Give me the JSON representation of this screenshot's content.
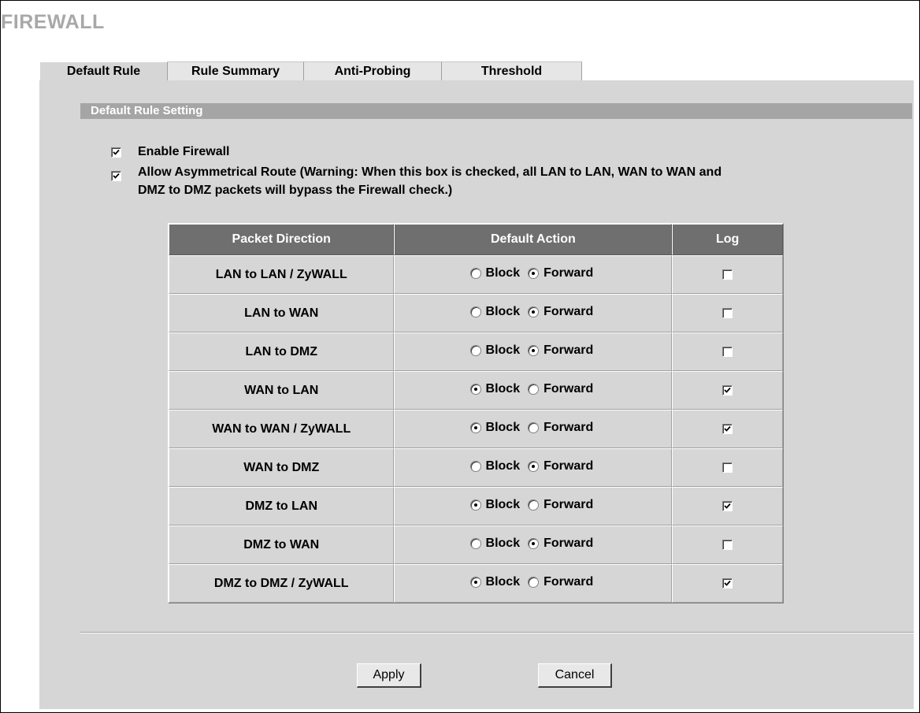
{
  "page": {
    "title": "FIREWALL"
  },
  "tabs": [
    {
      "label": "Default Rule",
      "active": true
    },
    {
      "label": "Rule Summary",
      "active": false
    },
    {
      "label": "Anti-Probing",
      "active": false
    },
    {
      "label": "Threshold",
      "active": false
    }
  ],
  "section": {
    "title": "Default Rule Setting"
  },
  "options": {
    "enable_firewall": {
      "label": "Enable Firewall",
      "checked": true
    },
    "asymmetrical_route": {
      "label_line1": "Allow Asymmetrical Route (Warning: When this box is checked, all LAN to LAN, WAN to WAN and",
      "label_line2": "DMZ to DMZ packets will bypass the Firewall check.)",
      "checked": true
    }
  },
  "table": {
    "headers": [
      "Packet Direction",
      "Default Action",
      "Log"
    ],
    "block_label": "Block",
    "forward_label": "Forward",
    "rows": [
      {
        "direction": "LAN to LAN / ZyWALL",
        "action": "Forward",
        "log": false
      },
      {
        "direction": "LAN to WAN",
        "action": "Forward",
        "log": false
      },
      {
        "direction": "LAN to DMZ",
        "action": "Forward",
        "log": false
      },
      {
        "direction": "WAN to LAN",
        "action": "Block",
        "log": true
      },
      {
        "direction": "WAN to WAN / ZyWALL",
        "action": "Block",
        "log": true
      },
      {
        "direction": "WAN to DMZ",
        "action": "Forward",
        "log": false
      },
      {
        "direction": "DMZ to LAN",
        "action": "Block",
        "log": true
      },
      {
        "direction": "DMZ to WAN",
        "action": "Forward",
        "log": false
      },
      {
        "direction": "DMZ to DMZ / ZyWALL",
        "action": "Block",
        "log": true
      }
    ]
  },
  "buttons": {
    "apply": "Apply",
    "cancel": "Cancel"
  },
  "colors": {
    "panel_bg": "#d6d6d6",
    "section_bar": "#a5a5a5",
    "table_header": "#6f6f6f",
    "title_gray": "#a8a8a8"
  }
}
